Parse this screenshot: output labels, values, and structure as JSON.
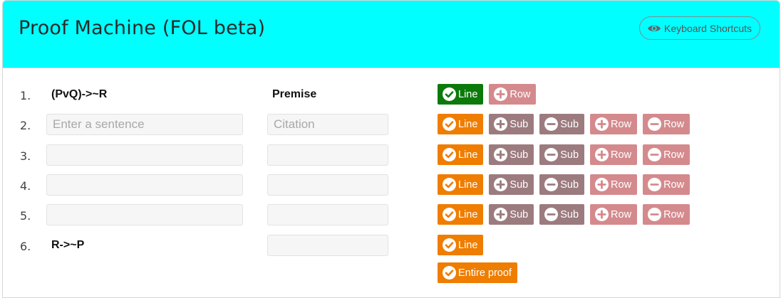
{
  "header": {
    "title": "Proof Machine (FOL beta)",
    "shortcuts_label": "Keyboard Shortcuts",
    "background": "#00ffff"
  },
  "labels": {
    "line": "Line",
    "sub": "Sub",
    "row": "Row",
    "entire_proof": "Entire proof"
  },
  "placeholders": {
    "sentence": "Enter a sentence",
    "citation": "Citation"
  },
  "lines": [
    {
      "num": "1.",
      "sentence": "(PvQ)->~R",
      "citation": "Premise"
    },
    {
      "num": "2.",
      "sentence": "",
      "citation": ""
    },
    {
      "num": "3.",
      "sentence": "",
      "citation": ""
    },
    {
      "num": "4.",
      "sentence": "",
      "citation": ""
    },
    {
      "num": "5.",
      "sentence": "",
      "citation": ""
    },
    {
      "num": "6.",
      "sentence": "R->~P",
      "citation": ""
    }
  ],
  "colors": {
    "checked_line": "#0b7a0b",
    "check": "#ef7d00",
    "sub": "#9c7b7f",
    "row": "#d48a8d"
  }
}
